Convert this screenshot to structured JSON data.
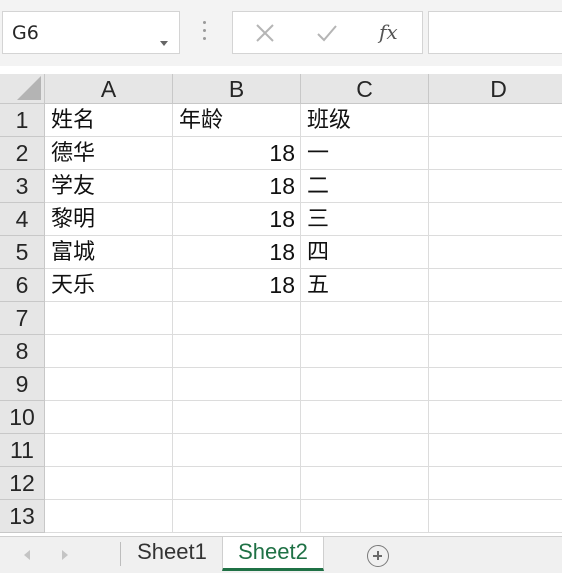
{
  "formula_bar": {
    "name_box": "G6",
    "formula": "",
    "icons": [
      "chevron-down-icon",
      "close-icon",
      "check-icon",
      "fx-icon"
    ],
    "fx_label": "fx"
  },
  "columns": [
    "A",
    "B",
    "C",
    "D"
  ],
  "rows": [
    {
      "header": "1",
      "cells": [
        "姓名",
        "年龄",
        "班级",
        ""
      ]
    },
    {
      "header": "2",
      "cells": [
        "德华",
        "18",
        "一",
        ""
      ]
    },
    {
      "header": "3",
      "cells": [
        "学友",
        "18",
        "二",
        ""
      ]
    },
    {
      "header": "4",
      "cells": [
        "黎明",
        "18",
        "三",
        ""
      ]
    },
    {
      "header": "5",
      "cells": [
        "富城",
        "18",
        "四",
        ""
      ]
    },
    {
      "header": "6",
      "cells": [
        "天乐",
        "18",
        "五",
        ""
      ]
    },
    {
      "header": "7",
      "cells": [
        "",
        "",
        "",
        ""
      ]
    },
    {
      "header": "8",
      "cells": [
        "",
        "",
        "",
        ""
      ]
    },
    {
      "header": "9",
      "cells": [
        "",
        "",
        "",
        ""
      ]
    },
    {
      "header": "10",
      "cells": [
        "",
        "",
        "",
        ""
      ]
    },
    {
      "header": "11",
      "cells": [
        "",
        "",
        "",
        ""
      ]
    },
    {
      "header": "12",
      "cells": [
        "",
        "",
        "",
        ""
      ]
    },
    {
      "header": "13",
      "cells": [
        "",
        "",
        "",
        ""
      ]
    }
  ],
  "sheet_tabs": {
    "tabs": [
      "Sheet1",
      "Sheet2"
    ],
    "active": "Sheet2",
    "icons": [
      "chevron-left-icon",
      "chevron-right-icon",
      "plus-circle-icon"
    ]
  },
  "colors": {
    "active_tab_accent": "#1f7145",
    "header_background": "#e6e6e6",
    "gridline": "#dcdcdc"
  }
}
